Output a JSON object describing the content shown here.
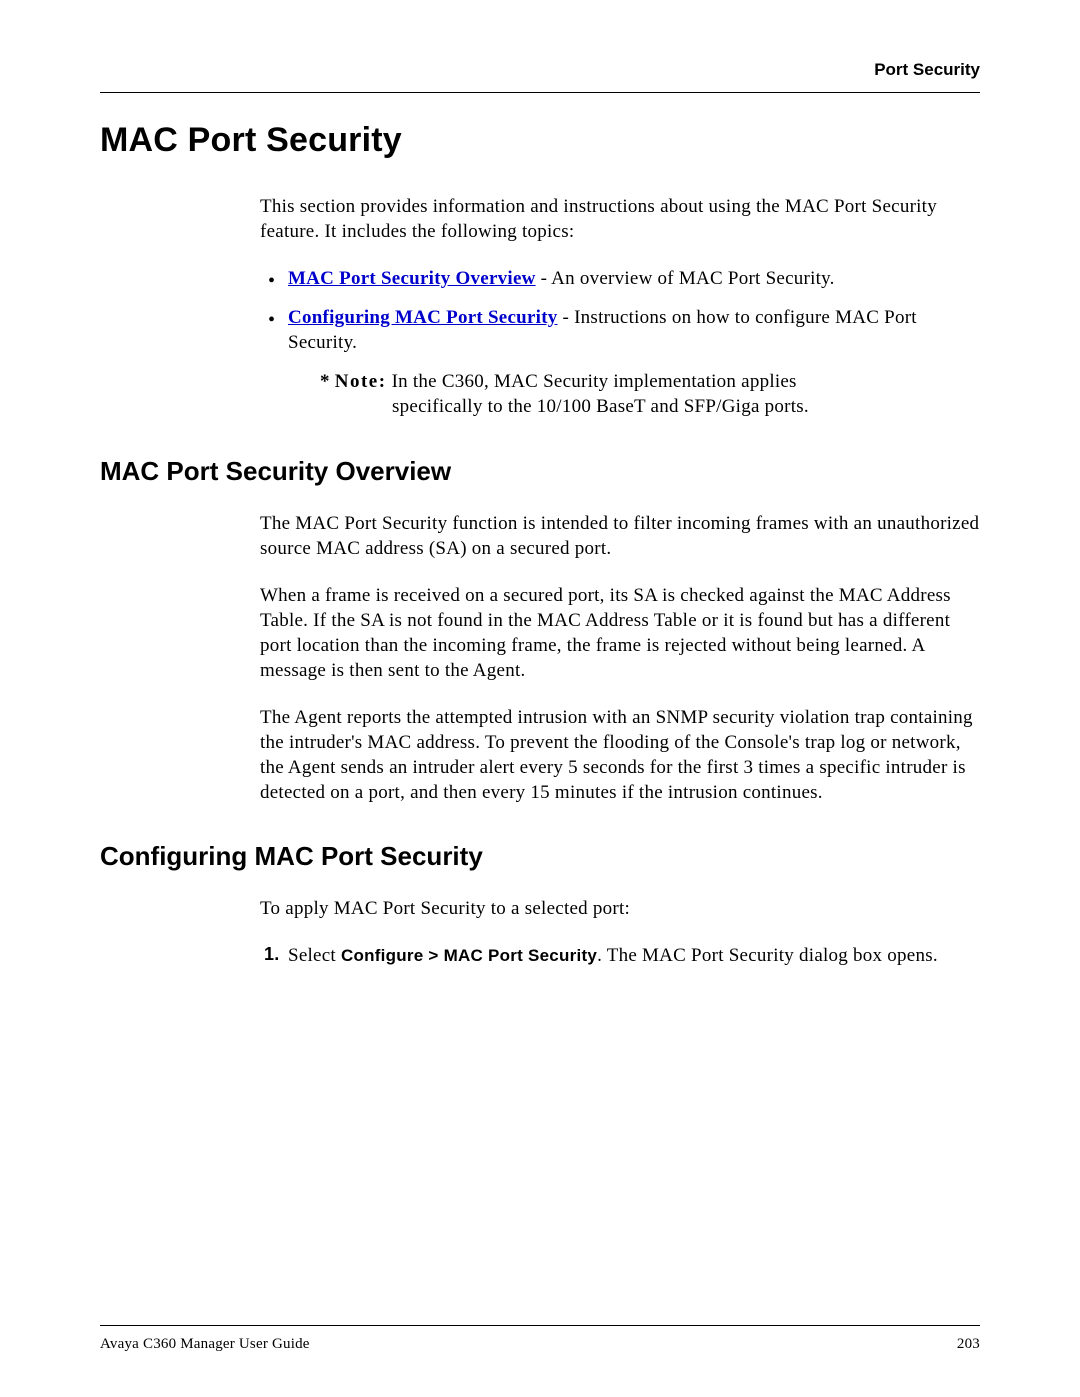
{
  "header": {
    "label": "Port Security"
  },
  "chapter": {
    "title": "MAC Port Security"
  },
  "intro": {
    "paragraph": "This section provides information and instructions about using the MAC Port Security feature. It includes the following topics:"
  },
  "topics": [
    {
      "link_text": "MAC Port Security Overview",
      "desc": " - An overview of MAC Port Security."
    },
    {
      "link_text": "Configuring MAC Port Security",
      "desc": " - Instructions on how to configure MAC Port Security."
    }
  ],
  "note": {
    "star": "* ",
    "label": "Note:",
    "text_line1": " In the C360, MAC Security implementation applies",
    "text_line2": "specifically to the 10/100 BaseT and SFP/Giga ports."
  },
  "section_overview": {
    "title": "MAC Port Security Overview",
    "p1": "The MAC Port Security function is intended to filter incoming frames with an unauthorized source MAC address (SA) on a secured port.",
    "p2": "When a frame is received on a secured port, its SA is checked against the MAC Address Table. If the SA is not found in the MAC Address Table or it is found but has a different port location than the incoming frame, the frame is rejected without being learned. A message is then sent to the Agent.",
    "p3": "The Agent reports the attempted intrusion with an SNMP security violation trap containing the intruder's MAC address. To prevent the flooding of the Console's trap log or network, the Agent sends an intruder alert every 5 seconds for the first 3 times a specific intruder is detected on a port, and then every 15 minutes if the intrusion continues."
  },
  "section_config": {
    "title": "Configuring MAC Port Security",
    "intro": "To apply MAC Port Security to a selected port:",
    "step1_num": "1.",
    "step1_prefix": "Select ",
    "step1_bold": "Configure > MAC Port Security",
    "step1_suffix": ". The MAC Port Security dialog box opens."
  },
  "footer": {
    "left": "Avaya C360 Manager User Guide",
    "right": "203"
  }
}
